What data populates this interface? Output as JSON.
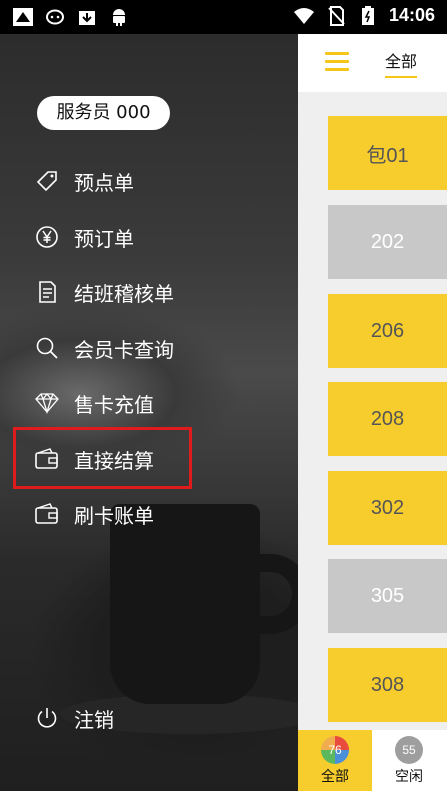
{
  "status_bar": {
    "time": "14:06",
    "left_icons": [
      "app-icon",
      "chat-icon",
      "download-icon",
      "android-icon"
    ],
    "right_icons": [
      "wifi-icon",
      "no-sim-icon",
      "battery-icon"
    ]
  },
  "drawer": {
    "staff_label": "服务员 000",
    "items": [
      {
        "label": "预点单",
        "icon": "tag-icon"
      },
      {
        "label": "预订单",
        "icon": "yen-icon"
      },
      {
        "label": "结班稽核单",
        "icon": "document-icon"
      },
      {
        "label": "会员卡查询",
        "icon": "search-icon"
      },
      {
        "label": "售卡充值",
        "icon": "diamond-icon"
      },
      {
        "label": "直接结算",
        "icon": "wallet-icon"
      },
      {
        "label": "刷卡账单",
        "icon": "wallet-icon"
      }
    ],
    "logout_label": "注销"
  },
  "panel": {
    "tab_label": "全部",
    "rooms": [
      {
        "name": "包01",
        "status": "occupied"
      },
      {
        "name": "202",
        "status": "idle"
      },
      {
        "name": "206",
        "status": "occupied"
      },
      {
        "name": "208",
        "status": "occupied"
      },
      {
        "name": "302",
        "status": "occupied"
      },
      {
        "name": "305",
        "status": "idle"
      },
      {
        "name": "308",
        "status": "occupied"
      }
    ],
    "bottom_tabs": [
      {
        "label": "全部",
        "count": "76"
      },
      {
        "label": "空闲",
        "count": "55"
      }
    ]
  },
  "colors": {
    "accent_yellow": "#f7cd2e",
    "idle_gray": "#c8c8c8",
    "highlight_red": "#e01b1b"
  }
}
